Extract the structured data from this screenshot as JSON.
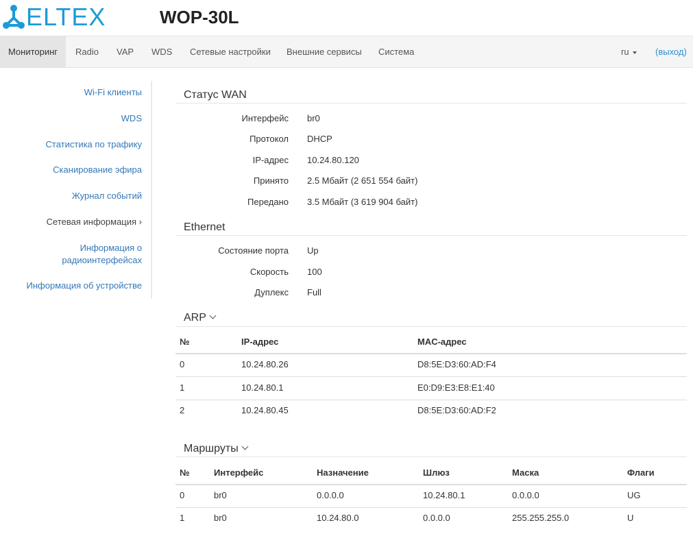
{
  "header": {
    "logo_text": "ELTEX",
    "device_title": "WOP-30L"
  },
  "nav": {
    "items": [
      "Мониторинг",
      "Radio",
      "VAP",
      "WDS",
      "Сетевые настройки",
      "Внешние сервисы",
      "Система"
    ],
    "active": "Мониторинг",
    "lang": "ru",
    "logout": "(выход)"
  },
  "sidebar": {
    "items": [
      "Wi-Fi клиенты",
      "WDS",
      "Статистика по трафику",
      "Сканирование эфира",
      "Журнал событий",
      "Сетевая информация ›",
      "Информация о",
      "радиоинтерфейсах",
      "Информация об устройстве"
    ],
    "current": "Сетевая информация"
  },
  "wan": {
    "title": "Статус WAN",
    "rows": [
      {
        "label": "Интерфейс",
        "value": "br0"
      },
      {
        "label": "Протокол",
        "value": "DHCP"
      },
      {
        "label": "IP-адрес",
        "value": "10.24.80.120"
      },
      {
        "label": "Принято",
        "value": "2.5 Мбайт (2 651 554 байт)"
      },
      {
        "label": "Передано",
        "value": "3.5 Мбайт (3 619 904 байт)"
      }
    ]
  },
  "ethernet": {
    "title": "Ethernet",
    "rows": [
      {
        "label": "Состояние порта",
        "value": "Up"
      },
      {
        "label": "Скорость",
        "value": "100"
      },
      {
        "label": "Дуплекс",
        "value": "Full"
      }
    ]
  },
  "arp": {
    "title": "ARP",
    "headers": [
      "№",
      "IP-адрес",
      "MAC-адрес"
    ],
    "rows": [
      [
        "0",
        "10.24.80.26",
        "D8:5E:D3:60:AD:F4"
      ],
      [
        "1",
        "10.24.80.1",
        "E0:D9:E3:E8:E1:40"
      ],
      [
        "2",
        "10.24.80.45",
        "D8:5E:D3:60:AD:F2"
      ]
    ]
  },
  "routes": {
    "title": "Маршруты",
    "headers": [
      "№",
      "Интерфейс",
      "Назначение",
      "Шлюз",
      "Маска",
      "Флаги"
    ],
    "rows": [
      [
        "0",
        "br0",
        "0.0.0.0",
        "10.24.80.1",
        "0.0.0.0",
        "UG"
      ],
      [
        "1",
        "br0",
        "10.24.80.0",
        "0.0.0.0",
        "255.255.255.0",
        "U"
      ]
    ]
  },
  "colors": {
    "brand": "#1d9ad6",
    "link": "#3478b7",
    "logout": "#2a8fd0"
  }
}
